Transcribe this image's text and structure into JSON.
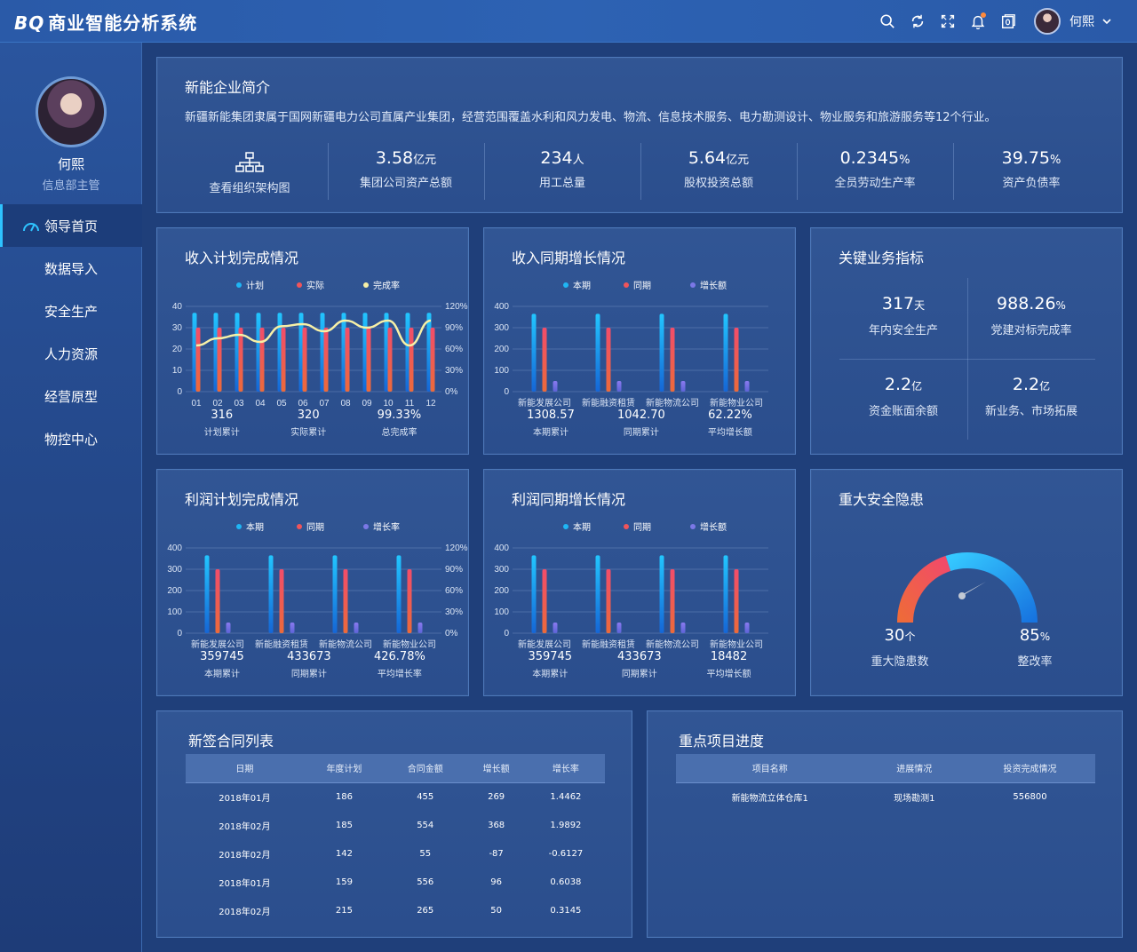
{
  "header": {
    "logo_mark": "BQ",
    "app_title": "商业智能分析系统",
    "user_name": "何熙"
  },
  "sidebar": {
    "user_name": "何熙",
    "user_role": "信息部主管",
    "items": [
      {
        "label": "领导首页",
        "active": true
      },
      {
        "label": "数据导入"
      },
      {
        "label": "安全生产"
      },
      {
        "label": "人力资源"
      },
      {
        "label": "经营原型"
      },
      {
        "label": "物控中心"
      }
    ]
  },
  "intro": {
    "title": "新能企业简介",
    "description": "新疆新能集团隶属于国网新疆电力公司直属产业集团，经营范围覆盖水利和风力发电、物流、信息技术服务、电力勘测设计、物业服务和旅游服务等12个行业。",
    "org_link": "查看组织架构图",
    "stats": [
      {
        "value": "3.58",
        "unit": "亿元",
        "label": "集团公司资产总额"
      },
      {
        "value": "234",
        "unit": "人",
        "label": "用工总量"
      },
      {
        "value": "5.64",
        "unit": "亿元",
        "label": "股权投资总额"
      },
      {
        "value": "0.2345",
        "unit": "%",
        "label": "全员劳动生产率"
      },
      {
        "value": "39.75",
        "unit": "%",
        "label": "资产负债率"
      }
    ]
  },
  "colors": {
    "cyan": "#1fb6f4",
    "red": "#f0545a",
    "purple": "#7b78e6",
    "line": "#f7f0a6"
  },
  "chart_data": [
    {
      "id": "income_plan",
      "title": "收入计划完成情况",
      "type": "bar",
      "categories": [
        "01",
        "02",
        "03",
        "04",
        "05",
        "06",
        "07",
        "08",
        "09",
        "10",
        "11",
        "12"
      ],
      "series": [
        {
          "name": "计划",
          "values": [
            37,
            37,
            37,
            37,
            37,
            37,
            37,
            37,
            37,
            37,
            37,
            37
          ]
        },
        {
          "name": "实际",
          "values": [
            30,
            30,
            30,
            30,
            30,
            30,
            30,
            30,
            30,
            30,
            30,
            30
          ]
        },
        {
          "name": "完成率",
          "kind": "line",
          "axis": "right",
          "values": [
            65,
            75,
            80,
            70,
            92,
            95,
            85,
            100,
            90,
            100,
            65,
            100
          ]
        }
      ],
      "ylim": [
        0,
        40
      ],
      "yticks": [
        0,
        10,
        20,
        30,
        40
      ],
      "y2ticks": [
        "0%",
        "30%",
        "60%",
        "90%",
        "120%"
      ],
      "y2lim": [
        0,
        120
      ],
      "summary": [
        {
          "value": "316",
          "label": "计划累计"
        },
        {
          "value": "320",
          "label": "实际累计"
        },
        {
          "value": "99.33%",
          "label": "总完成率"
        }
      ]
    },
    {
      "id": "income_yoy",
      "title": "收入同期增长情况",
      "type": "bar",
      "categories": [
        "新能发展公司",
        "新能融资租赁",
        "新能物流公司",
        "新能物业公司"
      ],
      "series": [
        {
          "name": "本期",
          "values": [
            365,
            365,
            365,
            365
          ]
        },
        {
          "name": "同期",
          "values": [
            300,
            300,
            300,
            300
          ]
        },
        {
          "name": "增长额",
          "values": [
            50,
            50,
            50,
            50
          ]
        }
      ],
      "ylim": [
        0,
        400
      ],
      "yticks": [
        0,
        100,
        200,
        300,
        400
      ],
      "summary": [
        {
          "value": "1308.57",
          "label": "本期累计"
        },
        {
          "value": "1042.70",
          "label": "同期累计"
        },
        {
          "value": "62.22%",
          "label": "平均增长额"
        }
      ]
    },
    {
      "id": "profit_plan",
      "title": "利润计划完成情况",
      "type": "bar",
      "categories": [
        "新能发展公司",
        "新能融资租赁",
        "新能物流公司",
        "新能物业公司"
      ],
      "series": [
        {
          "name": "本期",
          "values": [
            365,
            365,
            365,
            365
          ]
        },
        {
          "name": "同期",
          "values": [
            300,
            300,
            300,
            300
          ]
        },
        {
          "name": "增长率",
          "values": [
            50,
            50,
            50,
            50
          ]
        }
      ],
      "ylim": [
        0,
        400
      ],
      "yticks": [
        0,
        100,
        200,
        300,
        400
      ],
      "y2ticks": [
        "0%",
        "30%",
        "60%",
        "90%",
        "120%"
      ],
      "summary": [
        {
          "value": "359745",
          "label": "本期累计"
        },
        {
          "value": "433673",
          "label": "同期累计"
        },
        {
          "value": "426.78%",
          "label": "平均增长率"
        }
      ]
    },
    {
      "id": "profit_yoy",
      "title": "利润同期增长情况",
      "type": "bar",
      "categories": [
        "新能发展公司",
        "新能融资租赁",
        "新能物流公司",
        "新能物业公司"
      ],
      "series": [
        {
          "name": "本期",
          "values": [
            365,
            365,
            365,
            365
          ]
        },
        {
          "name": "同期",
          "values": [
            300,
            300,
            300,
            300
          ]
        },
        {
          "name": "增长额",
          "values": [
            50,
            50,
            50,
            50
          ]
        }
      ],
      "ylim": [
        0,
        400
      ],
      "yticks": [
        0,
        100,
        200,
        300,
        400
      ],
      "summary": [
        {
          "value": "359745",
          "label": "本期累计"
        },
        {
          "value": "433673",
          "label": "同期累计"
        },
        {
          "value": "18482",
          "label": "平均增长额"
        }
      ]
    }
  ],
  "kpi": {
    "title": "关键业务指标",
    "items": [
      {
        "value": "317",
        "unit": "天",
        "label": "年内安全生产"
      },
      {
        "value": "988.26",
        "unit": "%",
        "label": "党建对标完成率"
      },
      {
        "value": "2.2",
        "unit": "亿",
        "label": "资金账面余额"
      },
      {
        "value": "2.2",
        "unit": "亿",
        "label": "新业务、市场拓展"
      }
    ]
  },
  "safety": {
    "title": "重大安全隐患",
    "gauge_fraction": 0.6,
    "count_value": "30",
    "count_unit": "个",
    "count_label": "重大隐患数",
    "rate_value": "85",
    "rate_unit": "%",
    "rate_label": "整改率"
  },
  "contracts": {
    "title": "新签合同列表",
    "columns": [
      "日期",
      "年度计划",
      "合同金额",
      "增长额",
      "增长率"
    ],
    "rows": [
      [
        "2018年01月",
        "186",
        "455",
        "269",
        "1.4462"
      ],
      [
        "2018年02月",
        "185",
        "554",
        "368",
        "1.9892"
      ],
      [
        "2018年02月",
        "142",
        "55",
        "-87",
        "-0.6127"
      ],
      [
        "2018年01月",
        "159",
        "556",
        "96",
        "0.6038"
      ],
      [
        "2018年02月",
        "215",
        "265",
        "50",
        "0.3145"
      ]
    ]
  },
  "projects": {
    "title": "重点项目进度",
    "columns": [
      "项目名称",
      "进展情况",
      "投资完成情况"
    ],
    "rows": [
      [
        "新能物流立体仓库1",
        "现场勘测1",
        "556800"
      ]
    ]
  }
}
